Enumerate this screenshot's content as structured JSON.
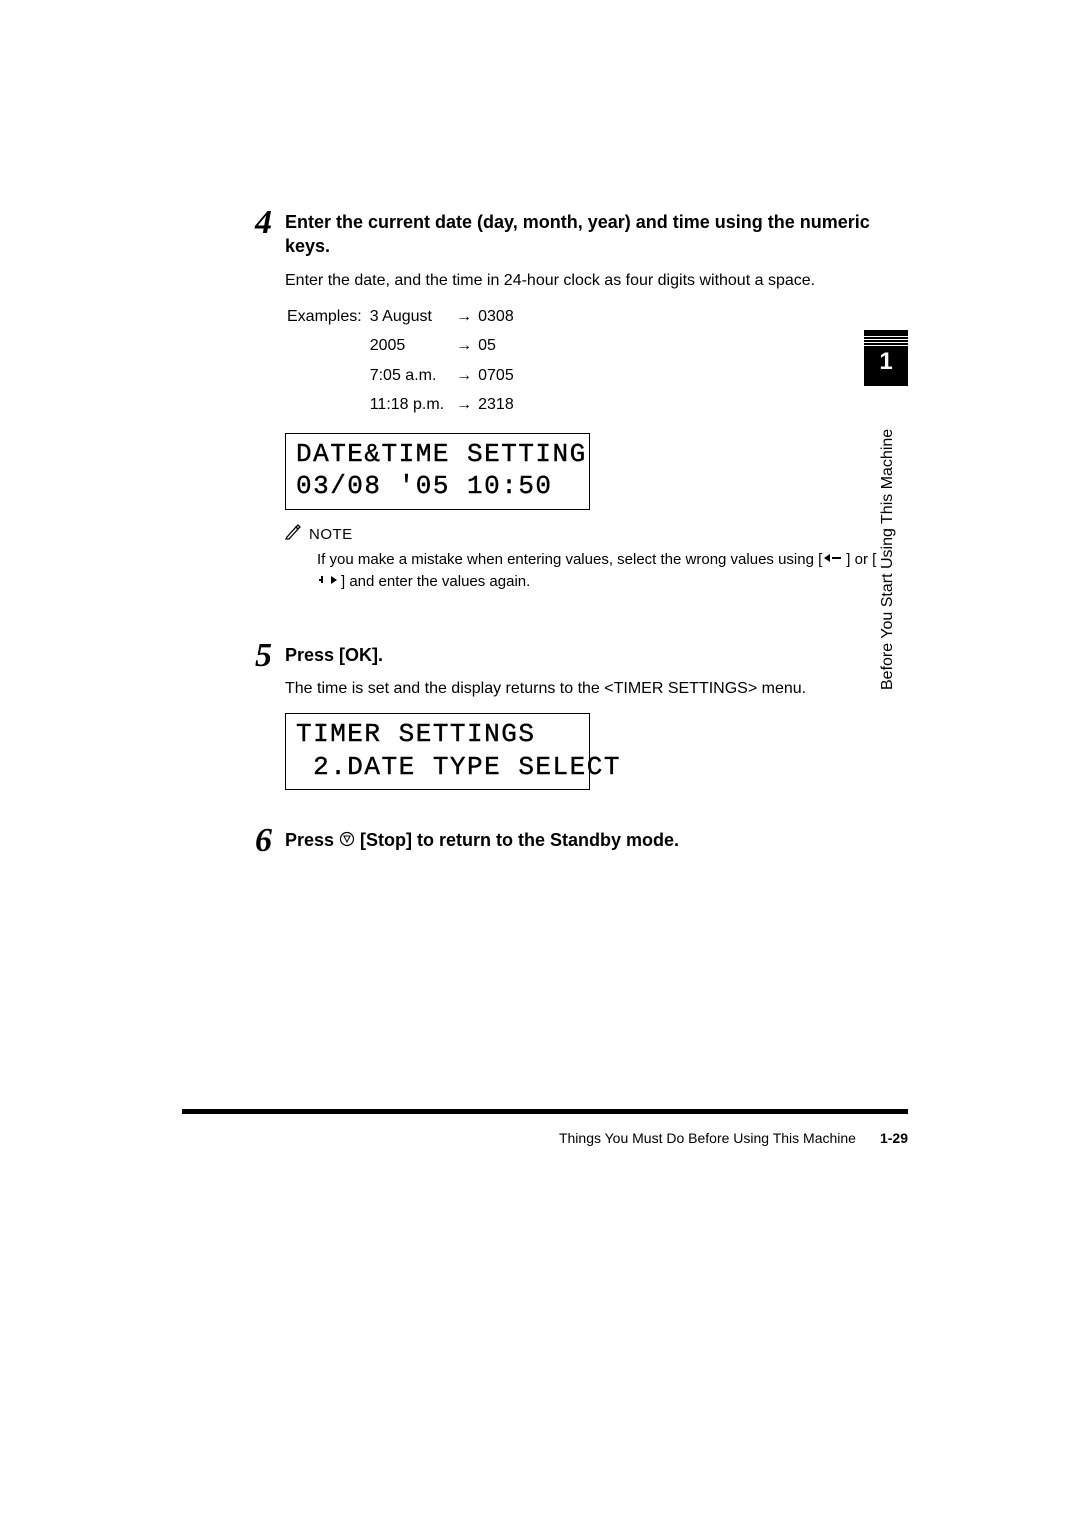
{
  "sideTab": {
    "number": "1"
  },
  "sideLabel": "Before You Start Using This Machine",
  "step4": {
    "num": "4",
    "title": "Enter the current date (day, month, year) and time using the numeric keys.",
    "desc": "Enter the date, and the time in 24-hour clock as four digits without a space.",
    "examples": {
      "label": "Examples:",
      "rows": [
        {
          "in": "3 August",
          "out": "0308"
        },
        {
          "in": "2005",
          "out": "05"
        },
        {
          "in": "7:05 a.m.",
          "out": "0705"
        },
        {
          "in": "11:18 p.m.",
          "out": "2318"
        }
      ]
    },
    "lcd": {
      "line1": "DATE&TIME SETTING",
      "line2": "03/08 '05 10:50"
    },
    "note": {
      "label": "NOTE",
      "pre": "If you make a mistake when entering values, select the wrong values using [",
      "mid": "] or [",
      "post": "] and enter the values again."
    }
  },
  "step5": {
    "num": "5",
    "title": "Press [OK].",
    "desc": "The time is set and the display returns to the <TIMER SETTINGS> menu.",
    "lcd": {
      "line1": "TIMER SETTINGS",
      "line2": " 2.DATE TYPE SELECT"
    }
  },
  "step6": {
    "num": "6",
    "title_pre": "Press ",
    "title_post": " [Stop] to return to the Standby mode."
  },
  "footer": {
    "section": "Things You Must Do Before Using This Machine",
    "pageNum": "1-29"
  }
}
